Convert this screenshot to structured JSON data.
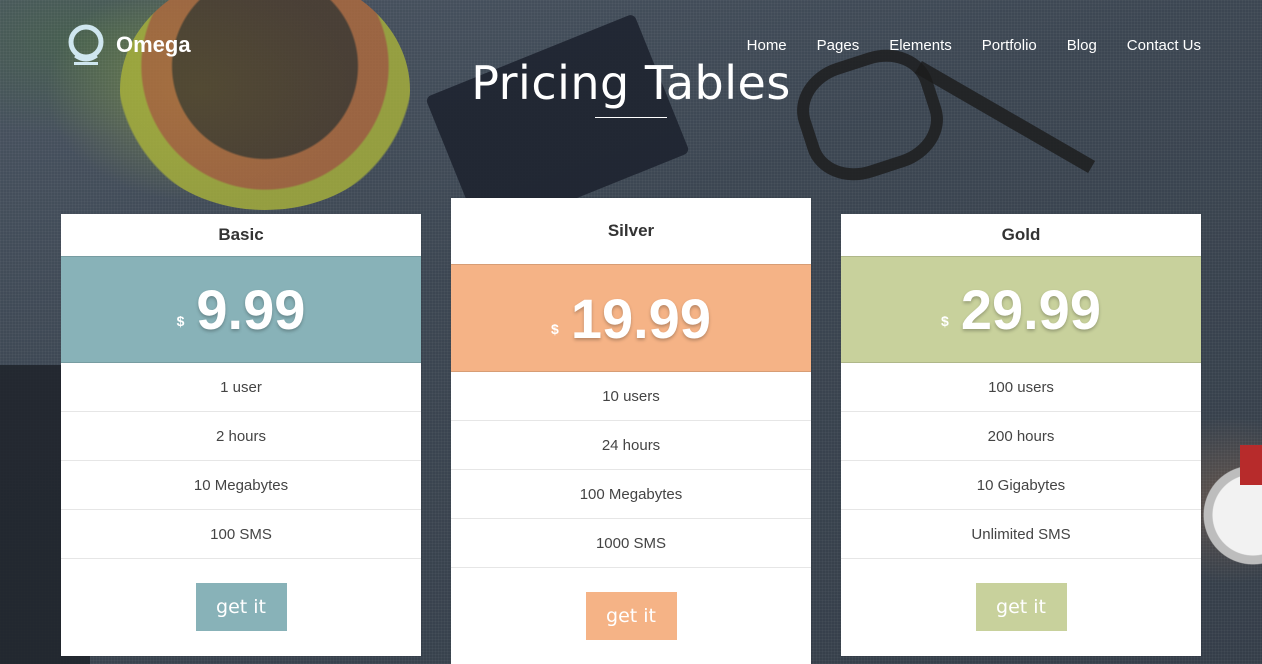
{
  "brand": {
    "name": "Omega",
    "logo_icon": "omega-ring-logo"
  },
  "nav": {
    "items": [
      {
        "label": "Home"
      },
      {
        "label": "Pages"
      },
      {
        "label": "Elements"
      },
      {
        "label": "Portfolio"
      },
      {
        "label": "Blog"
      },
      {
        "label": "Contact Us"
      }
    ]
  },
  "page": {
    "title": "Pricing Tables"
  },
  "plans": [
    {
      "name": "Basic",
      "currency": "$",
      "price": "9.99",
      "color": "#88b2b8",
      "features": [
        "1 user",
        "2 hours",
        "10 Megabytes",
        "100 SMS"
      ],
      "button_label": "get it"
    },
    {
      "name": "Silver",
      "currency": "$",
      "price": "19.99",
      "color": "#f5b386",
      "features": [
        "10 users",
        "24 hours",
        "100 Megabytes",
        "1000 SMS"
      ],
      "button_label": "get it"
    },
    {
      "name": "Gold",
      "currency": "$",
      "price": "29.99",
      "color": "#c8d19c",
      "features": [
        "100 users",
        "200 hours",
        "10 Gigabytes",
        "Unlimited SMS"
      ],
      "button_label": "get it"
    }
  ]
}
